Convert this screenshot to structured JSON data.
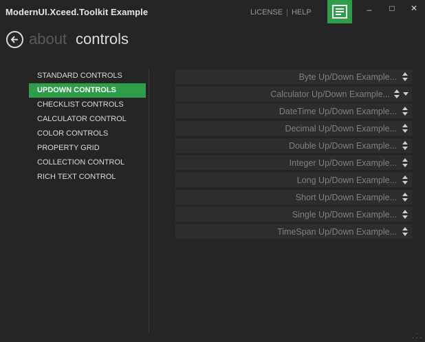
{
  "window": {
    "title": "ModernUI.Xceed.Toolkit Example",
    "links": [
      "LICENSE",
      "HELP"
    ],
    "minimize": "_",
    "maximize": "□",
    "close": "✕"
  },
  "breadcrumb": {
    "previous": "about",
    "current": "controls"
  },
  "nav": {
    "items": [
      {
        "label": "STANDARD CONTROLS"
      },
      {
        "label": "UPDOWN CONTROLS",
        "active": true
      },
      {
        "label": "CHECKLIST CONTROLS"
      },
      {
        "label": "CALCULATOR CONTROL"
      },
      {
        "label": "COLOR CONTROLS"
      },
      {
        "label": "PROPERTY GRID"
      },
      {
        "label": "COLLECTION CONTROL"
      },
      {
        "label": "RICH TEXT CONTROL"
      }
    ]
  },
  "updowns": [
    {
      "text": "Byte Up/Down Example..."
    },
    {
      "text": "Calculator Up/Down Example...",
      "dropdown": true
    },
    {
      "text": "DateTime Up/Down Example..."
    },
    {
      "text": "Decimal Up/Down Example..."
    },
    {
      "text": "Double Up/Down Example..."
    },
    {
      "text": "Integer Up/Down Example..."
    },
    {
      "text": "Long Up/Down Example..."
    },
    {
      "text": "Short Up/Down Example..."
    },
    {
      "text": "Single Up/Down Example..."
    },
    {
      "text": "TimeSpan Up/Down Example..."
    }
  ],
  "colors": {
    "accent": "#2f9e4a",
    "background": "#252526"
  },
  "icons": {
    "back": "arrow-left-icon",
    "menu": "menu-icon",
    "resize": "resize-grip-icon"
  }
}
